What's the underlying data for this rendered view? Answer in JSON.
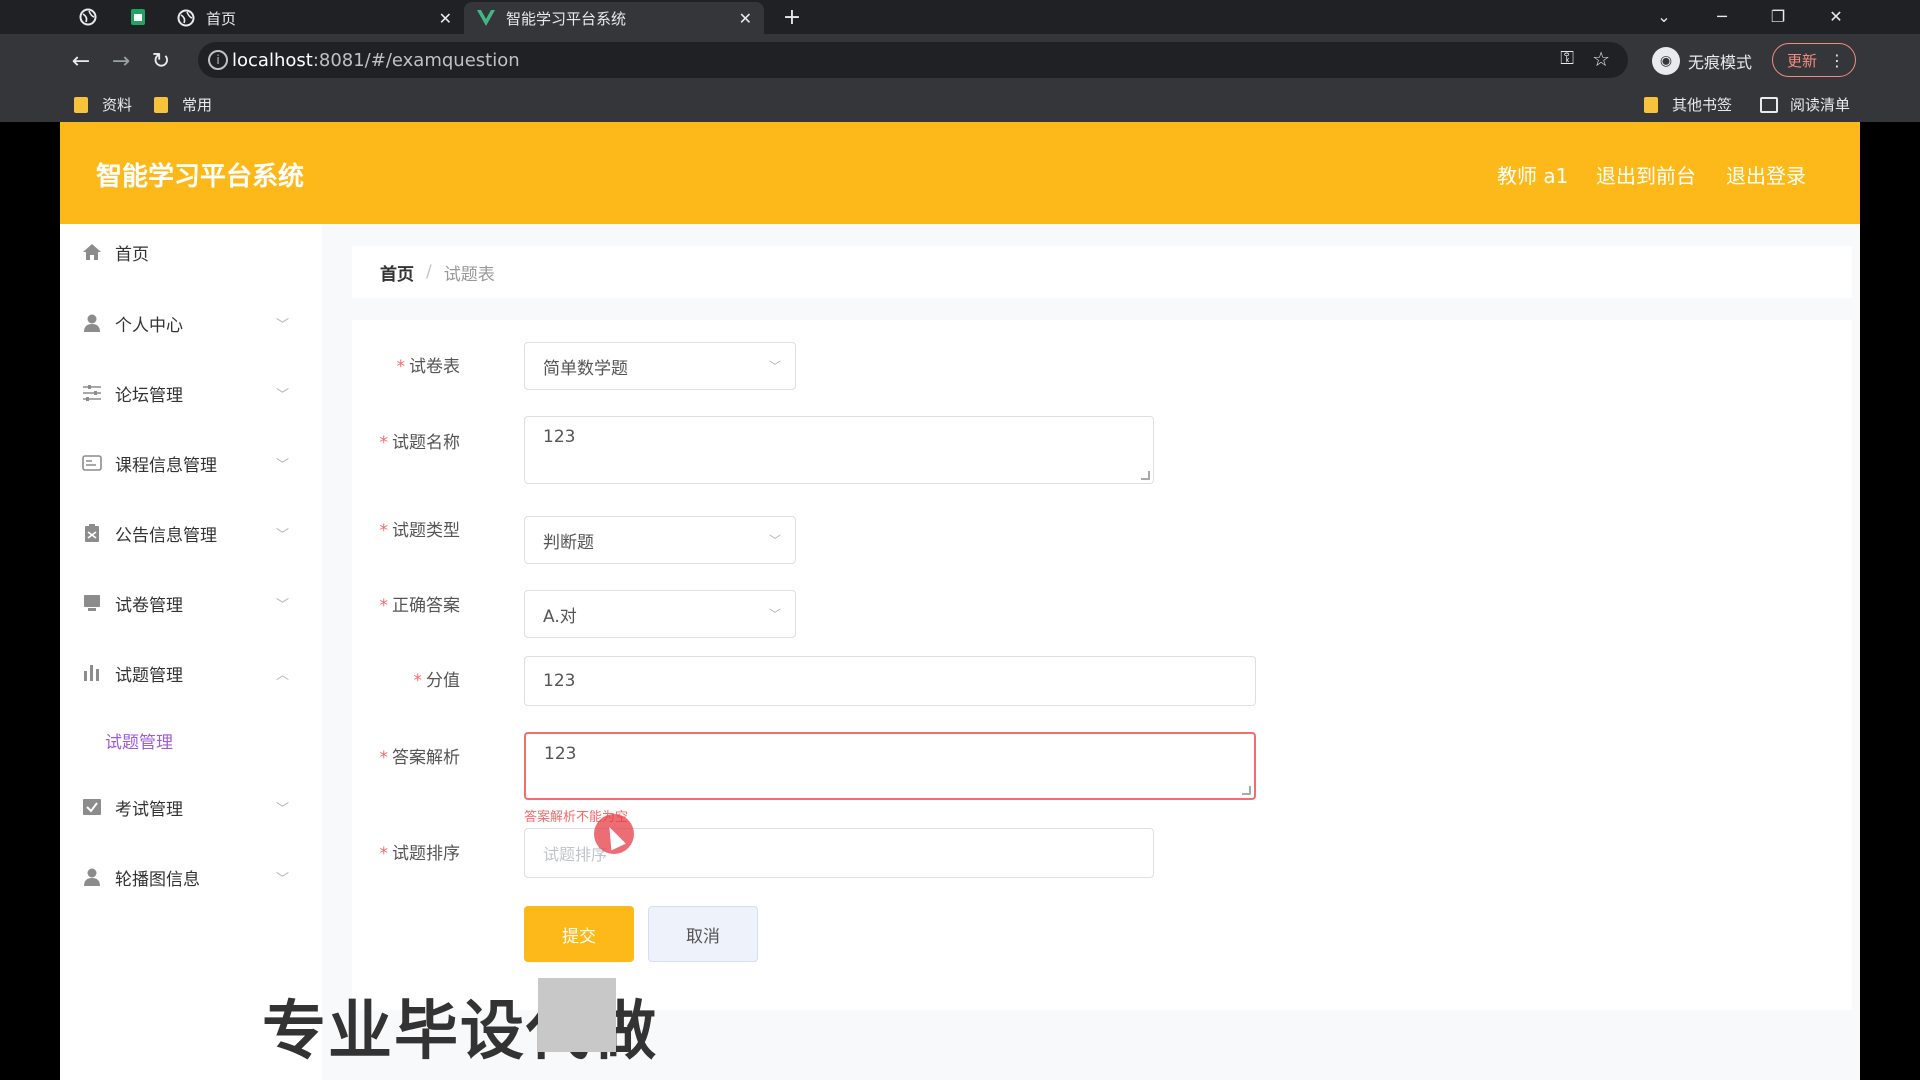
{
  "browser": {
    "tabs": [
      {
        "label": "首页"
      },
      {
        "label": "智能学习平台系统"
      }
    ],
    "url_host": "localhost",
    "url_rest": ":8081/#/examquestion",
    "incognito_label": "无痕模式",
    "update_label": "更新",
    "bookmarks": [
      "资料",
      "常用"
    ],
    "other_bookmarks": "其他书签",
    "reading_list": "阅读清单"
  },
  "header": {
    "title": "智能学习平台系统",
    "user": "教师 a1",
    "to_front": "退出到前台",
    "logout": "退出登录"
  },
  "sidebar": {
    "items": [
      {
        "label": "首页"
      },
      {
        "label": "个人中心"
      },
      {
        "label": "论坛管理"
      },
      {
        "label": "课程信息管理"
      },
      {
        "label": "公告信息管理"
      },
      {
        "label": "试卷管理"
      },
      {
        "label": "试题管理"
      },
      {
        "label": "考试管理"
      },
      {
        "label": "轮播图信息"
      }
    ],
    "submenu_active": "试题管理"
  },
  "breadcrumb": {
    "home": "首页",
    "separator": "/",
    "current": "试题表"
  },
  "form": {
    "paper_label": "试卷表",
    "paper_value": "简单数学题",
    "name_label": "试题名称",
    "name_value": "123",
    "type_label": "试题类型",
    "type_value": "判断题",
    "answer_label": "正确答案",
    "answer_value": "A.对",
    "score_label": "分值",
    "score_value": "123",
    "analysis_label": "答案解析",
    "analysis_value": "123",
    "analysis_error": "答案解析不能为空",
    "order_label": "试题排序",
    "order_placeholder": "试题排序",
    "required_mark": "*",
    "submit_label": "提交",
    "cancel_label": "取消"
  },
  "watermark": "专业毕设代做",
  "colors": {
    "header_bg": "#fdb919",
    "accent_purple": "#9c5dd6",
    "error_red": "#f56c6c"
  }
}
